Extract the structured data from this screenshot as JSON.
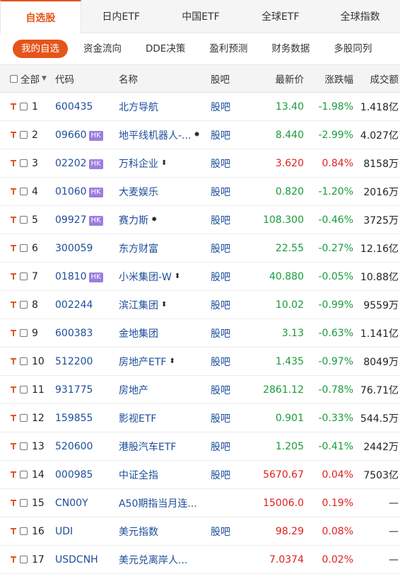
{
  "tabs": [
    "自选股",
    "日内ETF",
    "中国ETF",
    "全球ETF",
    "全球指数"
  ],
  "subtabs": [
    "我的自选",
    "资金流向",
    "DDE决策",
    "盈利预测",
    "财务数据",
    "多股同列"
  ],
  "header": {
    "all": "全部",
    "code": "代码",
    "name": "名称",
    "bar": "股吧",
    "price": "最新价",
    "change": "涨跌幅",
    "volume": "成交额"
  },
  "colors": {
    "accent": "#e5541a",
    "up": "#e02020",
    "down": "#1a9b3a",
    "link": "#1d4e9b",
    "hk_badge": "#9b7de0"
  },
  "rows": [
    {
      "idx": "1",
      "code": "600435",
      "hk": "",
      "name": "北方导航",
      "mark": "",
      "bar": "股吧",
      "price": "13.40",
      "change": "-1.98%",
      "volume": "1.418亿",
      "dir": "down"
    },
    {
      "idx": "2",
      "code": "09660",
      "hk": "HK",
      "name": "地平线机器人-...",
      "mark": "✸",
      "bar": "股吧",
      "price": "8.440",
      "change": "-2.99%",
      "volume": "4.027亿",
      "dir": "down"
    },
    {
      "idx": "3",
      "code": "02202",
      "hk": "HK",
      "name": "万科企业",
      "mark": "⬍",
      "bar": "股吧",
      "price": "3.620",
      "change": "0.84%",
      "volume": "8158万",
      "dir": "up"
    },
    {
      "idx": "4",
      "code": "01060",
      "hk": "HK",
      "name": "大麦娱乐",
      "mark": "",
      "bar": "股吧",
      "price": "0.820",
      "change": "-1.20%",
      "volume": "2016万",
      "dir": "down"
    },
    {
      "idx": "5",
      "code": "09927",
      "hk": "HK",
      "name": "赛力斯",
      "mark": "✸",
      "bar": "股吧",
      "price": "108.300",
      "change": "-0.46%",
      "volume": "3725万",
      "dir": "down"
    },
    {
      "idx": "6",
      "code": "300059",
      "hk": "",
      "name": "东方财富",
      "mark": "",
      "bar": "股吧",
      "price": "22.55",
      "change": "-0.27%",
      "volume": "12.16亿",
      "dir": "down"
    },
    {
      "idx": "7",
      "code": "01810",
      "hk": "HK",
      "name": "小米集团-W",
      "mark": "⬍",
      "bar": "股吧",
      "price": "40.880",
      "change": "-0.05%",
      "volume": "10.88亿",
      "dir": "down"
    },
    {
      "idx": "8",
      "code": "002244",
      "hk": "",
      "name": "滨江集团",
      "mark": "⬍",
      "bar": "股吧",
      "price": "10.02",
      "change": "-0.99%",
      "volume": "9559万",
      "dir": "down"
    },
    {
      "idx": "9",
      "code": "600383",
      "hk": "",
      "name": "金地集团",
      "mark": "",
      "bar": "股吧",
      "price": "3.13",
      "change": "-0.63%",
      "volume": "1.141亿",
      "dir": "down"
    },
    {
      "idx": "10",
      "code": "512200",
      "hk": "",
      "name": "房地产ETF",
      "mark": "⬍",
      "bar": "股吧",
      "price": "1.435",
      "change": "-0.97%",
      "volume": "8049万",
      "dir": "down"
    },
    {
      "idx": "11",
      "code": "931775",
      "hk": "",
      "name": "房地产",
      "mark": "",
      "bar": "股吧",
      "price": "2861.12",
      "change": "-0.78%",
      "volume": "76.71亿",
      "dir": "down"
    },
    {
      "idx": "12",
      "code": "159855",
      "hk": "",
      "name": "影视ETF",
      "mark": "",
      "bar": "股吧",
      "price": "0.901",
      "change": "-0.33%",
      "volume": "544.5万",
      "dir": "down"
    },
    {
      "idx": "13",
      "code": "520600",
      "hk": "",
      "name": "港股汽车ETF",
      "mark": "",
      "bar": "股吧",
      "price": "1.205",
      "change": "-0.41%",
      "volume": "2442万",
      "dir": "down"
    },
    {
      "idx": "14",
      "code": "000985",
      "hk": "",
      "name": "中证全指",
      "mark": "",
      "bar": "股吧",
      "price": "5670.67",
      "change": "0.04%",
      "volume": "7503亿",
      "dir": "up"
    },
    {
      "idx": "15",
      "code": "CN00Y",
      "hk": "",
      "name": "A50期指当月连...",
      "mark": "",
      "bar": "",
      "price": "15006.0",
      "change": "0.19%",
      "volume": "—",
      "dir": "up"
    },
    {
      "idx": "16",
      "code": "UDI",
      "hk": "",
      "name": "美元指数",
      "mark": "",
      "bar": "股吧",
      "price": "98.29",
      "change": "0.08%",
      "volume": "—",
      "dir": "up"
    },
    {
      "idx": "17",
      "code": "USDCNH",
      "hk": "",
      "name": "美元兑离岸人...",
      "mark": "",
      "bar": "",
      "price": "7.0374",
      "change": "0.02%",
      "volume": "—",
      "dir": "up"
    }
  ]
}
